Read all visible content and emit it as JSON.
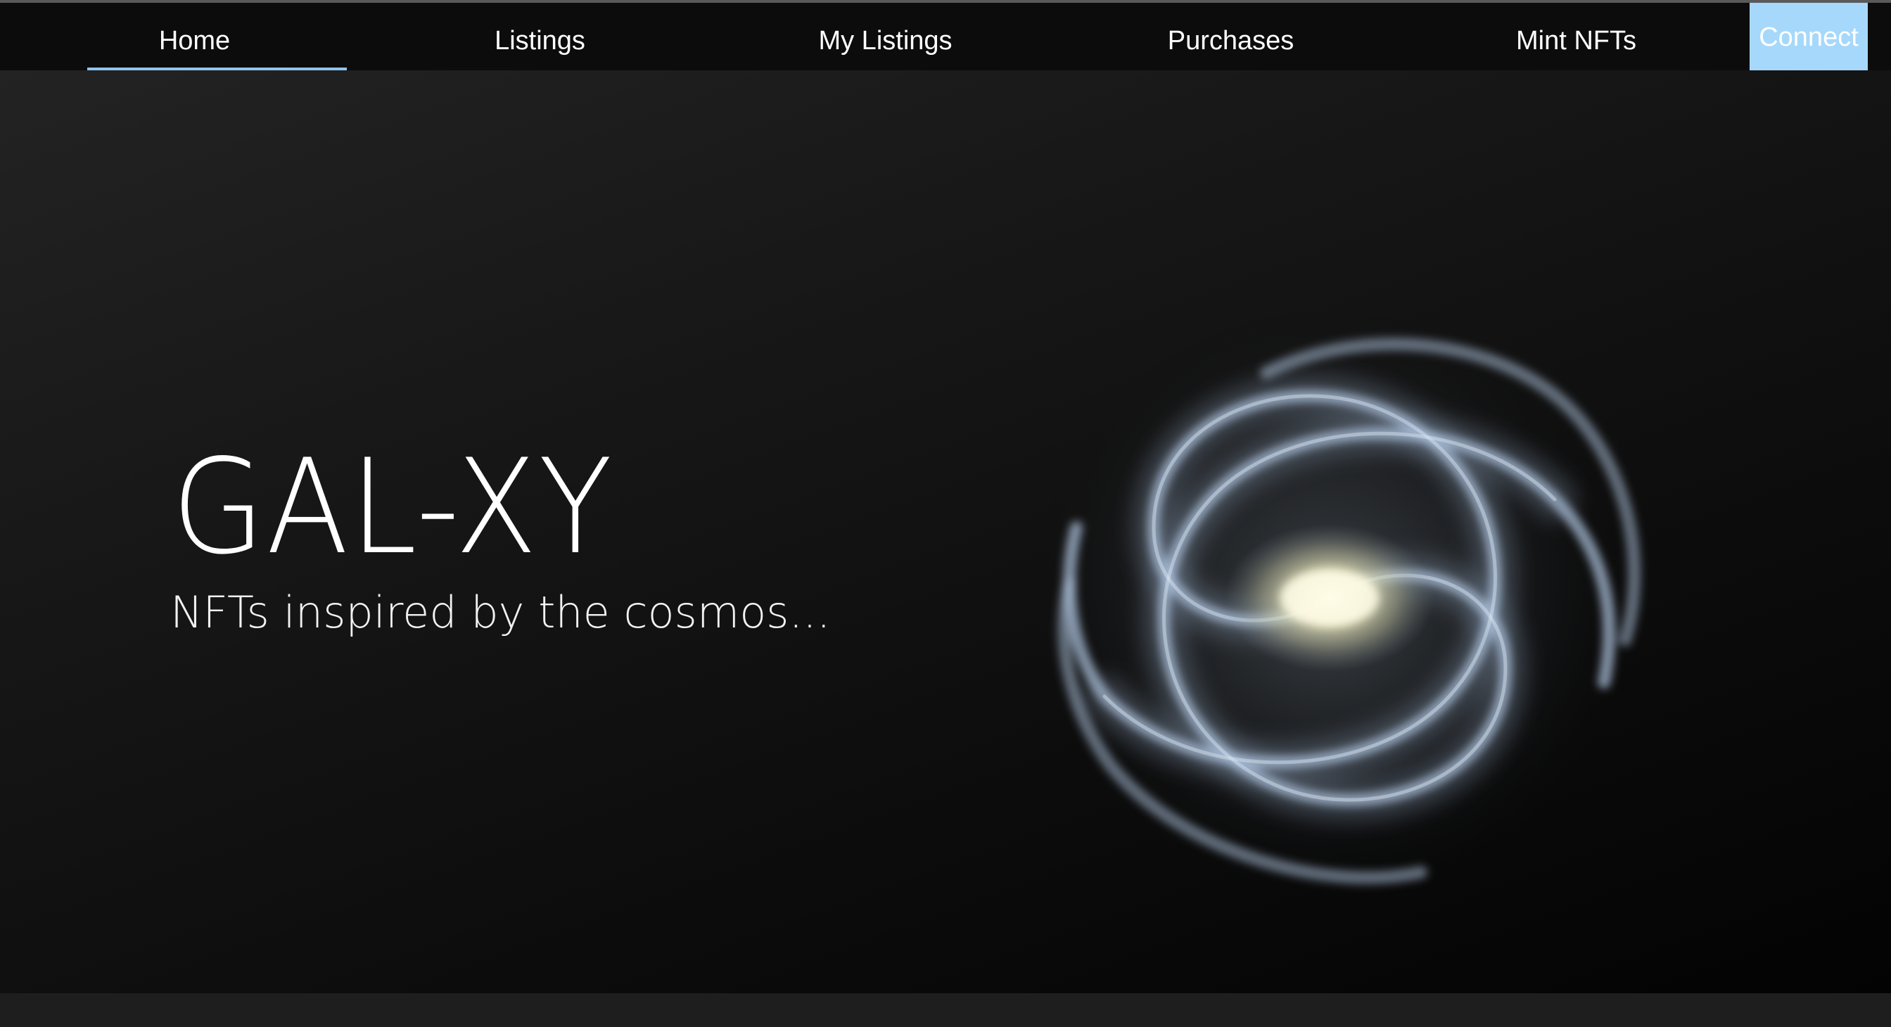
{
  "nav": {
    "tabs": [
      {
        "label": "Home",
        "active": true
      },
      {
        "label": "Listings",
        "active": false
      },
      {
        "label": "My Listings",
        "active": false
      },
      {
        "label": "Purchases",
        "active": false
      },
      {
        "label": "Mint NFTs",
        "active": false
      }
    ],
    "connect_label": "Connect"
  },
  "hero": {
    "title": "GAL-XY",
    "subtitle": "NFTs inspired by the cosmos...",
    "image": "spiral-galaxy"
  },
  "colors": {
    "accent": "#8fc4ec",
    "connect_bg": "#a6d8fb",
    "navbar_bg": "#0c0c0c"
  }
}
